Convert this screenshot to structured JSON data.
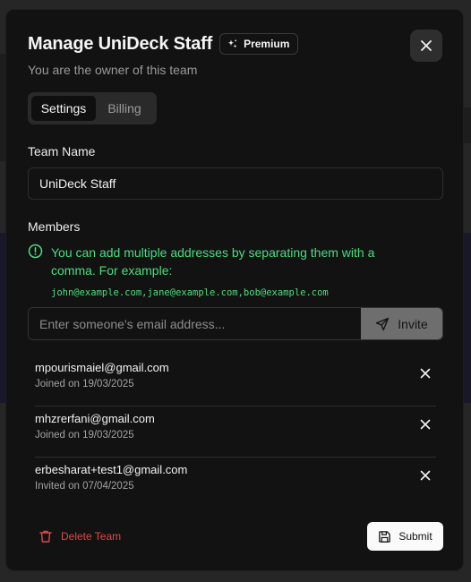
{
  "modal": {
    "title": "Manage UniDeck Staff",
    "badge_label": "Premium",
    "subtitle": "You are the owner of this team"
  },
  "tabs": [
    {
      "label": "Settings",
      "active": true
    },
    {
      "label": "Billing",
      "active": false
    }
  ],
  "team_name": {
    "label": "Team Name",
    "value": "UniDeck Staff"
  },
  "members": {
    "label": "Members",
    "info": "You can add multiple addresses by separating them with a comma. For example:",
    "example": "john@example.com,jane@example.com,bob@example.com",
    "email_placeholder": "Enter someone's email address...",
    "invite_label": "Invite",
    "list": [
      {
        "email": "mpourismaiel@gmail.com",
        "meta": "Joined on 19/03/2025"
      },
      {
        "email": "mhzrerfani@gmail.com",
        "meta": "Joined on 19/03/2025"
      },
      {
        "email": "erbesharat+test1@gmail.com",
        "meta": "Invited on 07/04/2025"
      }
    ]
  },
  "footer": {
    "delete_label": "Delete Team",
    "submit_label": "Submit"
  },
  "colors": {
    "accent_green": "#4ade80",
    "danger_red": "#e04848",
    "modal_bg": "#121212"
  },
  "icons": [
    "sparkles-icon",
    "close-icon",
    "info-icon",
    "send-icon",
    "remove-icon",
    "trash-icon",
    "save-icon"
  ]
}
